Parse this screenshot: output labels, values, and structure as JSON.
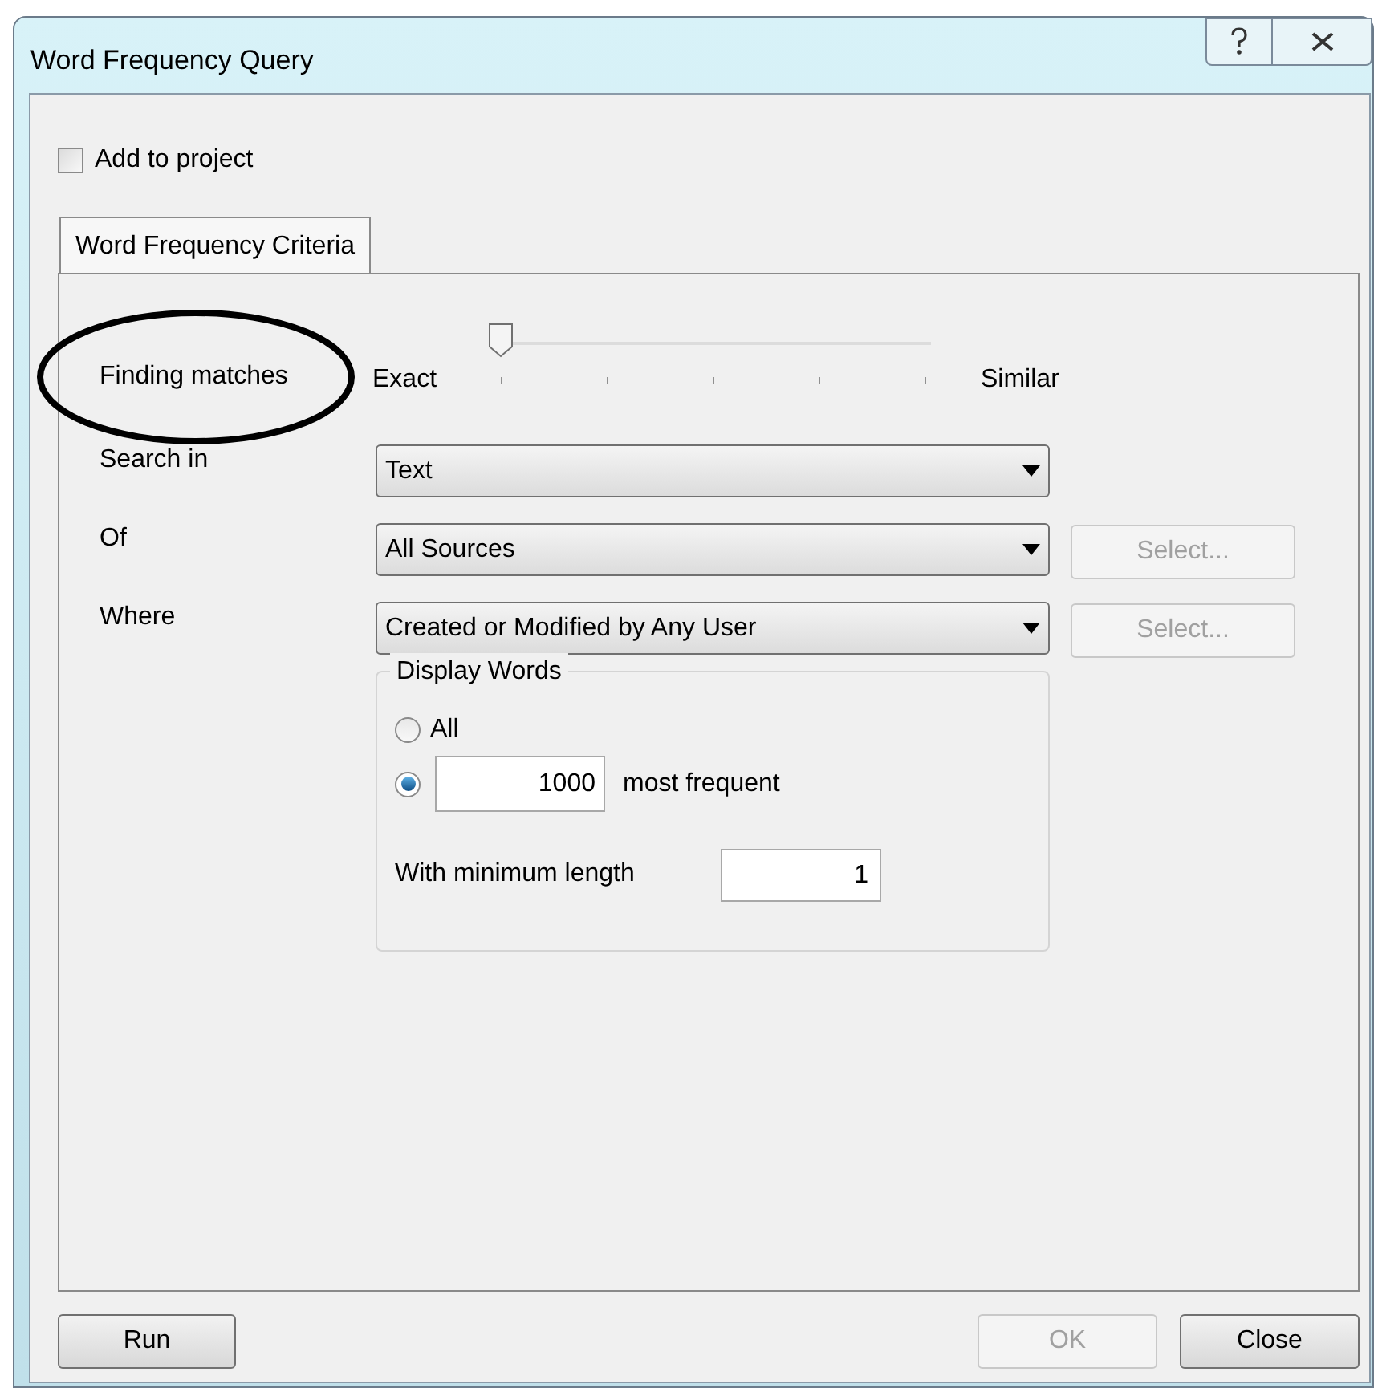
{
  "window": {
    "title": "Word Frequency Query"
  },
  "add_to_project": {
    "label": "Add to project",
    "checked": false
  },
  "tabs": [
    {
      "label": "Word Frequency Criteria",
      "selected": true
    }
  ],
  "finding_matches": {
    "label": "Finding matches",
    "min_label": "Exact",
    "max_label": "Similar",
    "level": 0
  },
  "criteria": [
    {
      "label": "Search in",
      "value": "Text"
    },
    {
      "label": "Of",
      "value": "All Sources",
      "button": {
        "label": "Select...",
        "disabled": true
      }
    },
    {
      "label": "Where",
      "value": "Created or Modified by Any User",
      "button": {
        "label": "Select...",
        "disabled": true
      }
    }
  ],
  "display_words": {
    "title": "Display Words",
    "options": [
      {
        "kind": "all",
        "label": "All",
        "selected": false
      },
      {
        "kind": "count",
        "value": "1000",
        "label": "most frequent",
        "selected": true
      }
    ],
    "min_length": {
      "label": "With minimum length",
      "value": "1"
    }
  },
  "footer": {
    "left_buttons": [
      {
        "label": "Run",
        "disabled": false
      }
    ],
    "right_buttons": [
      {
        "label": "OK",
        "disabled": true
      },
      {
        "label": "Close",
        "disabled": false
      }
    ]
  }
}
